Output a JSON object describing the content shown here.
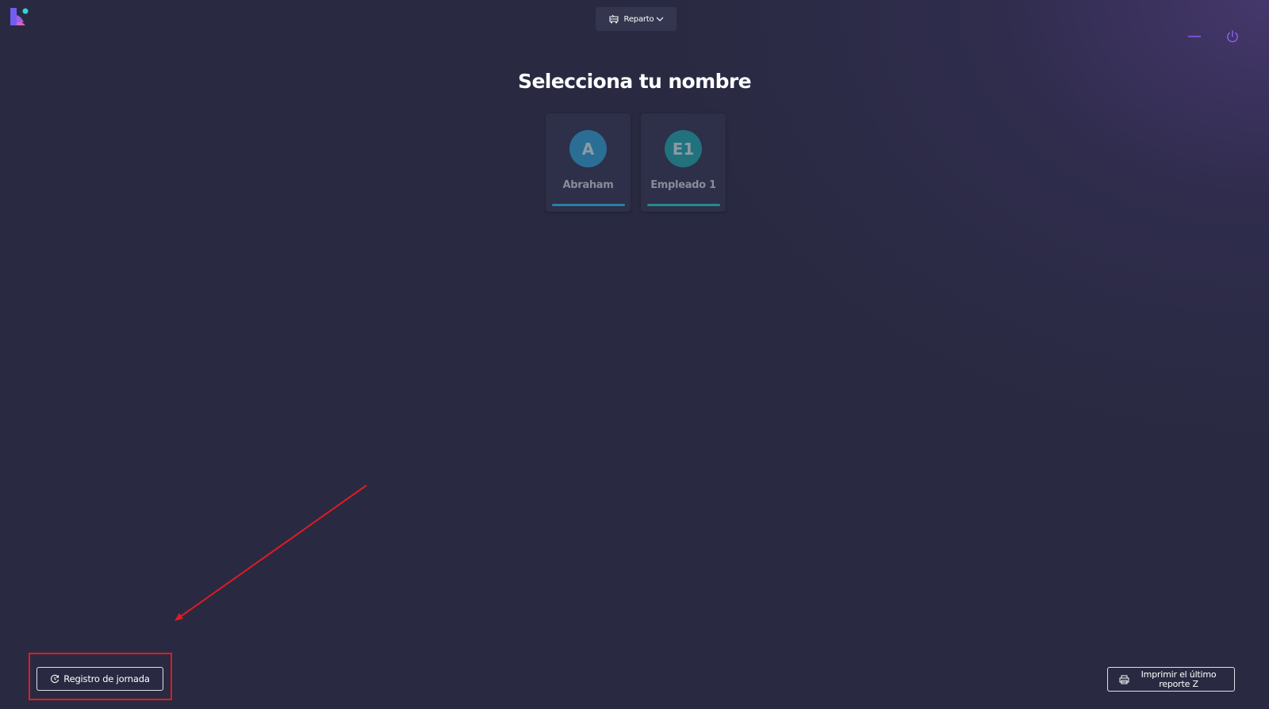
{
  "app": {
    "logo_icon": "app-logo-icon"
  },
  "header": {
    "mode_selector": {
      "icon": "delivery-icon",
      "selected": "Reparto",
      "chevron_icon": "chevron-down-icon"
    },
    "window_controls": {
      "minimize_icon": "minimize-icon",
      "power_icon": "power-icon",
      "accent_color": "#8b5cf6"
    }
  },
  "main": {
    "title": "Selecciona tu nombre",
    "users": [
      {
        "initials": "A",
        "name": "Abraham",
        "avatar_color": "#2a6e96",
        "bar_color": "#2a7fa8"
      },
      {
        "initials": "E1",
        "name": "Empleado 1",
        "avatar_color": "#21727d",
        "bar_color": "#25898f"
      }
    ]
  },
  "footer": {
    "registro_button": {
      "icon": "clock-refresh-icon",
      "label": "Registro de jornada"
    },
    "imprimir_button": {
      "icon": "printer-icon",
      "label_line1": "Imprimir el último",
      "label_line2": "reporte Z"
    }
  },
  "annotation": {
    "highlight_color": "#e01b24"
  }
}
